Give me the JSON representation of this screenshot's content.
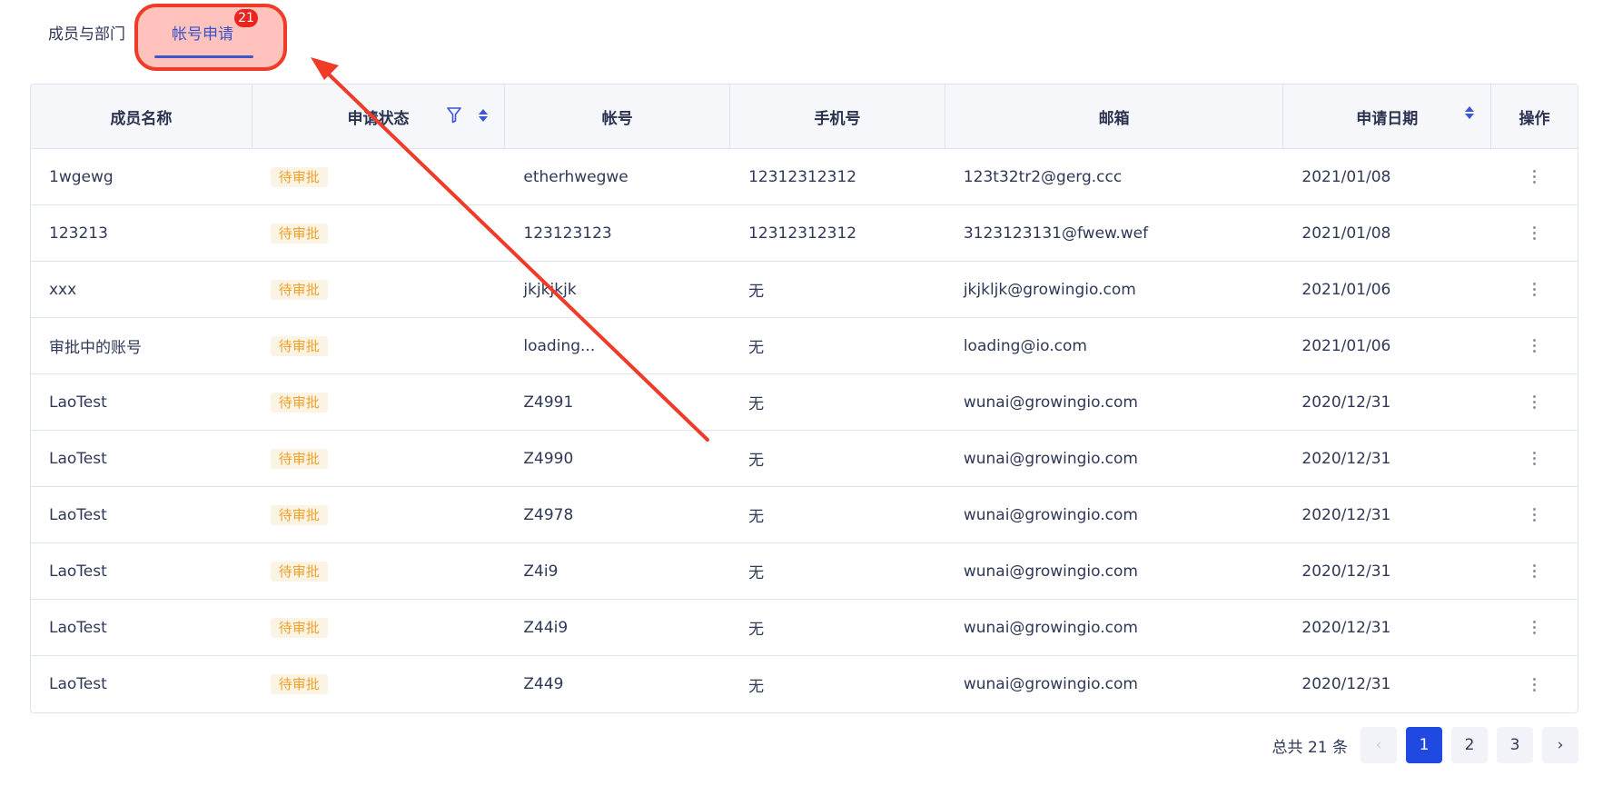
{
  "tabs": {
    "members_label": "成员与部门",
    "apply_label": "帐号申请",
    "apply_badge": "21"
  },
  "table": {
    "columns": [
      "成员名称",
      "申请状态",
      "帐号",
      "手机号",
      "邮箱",
      "申请日期",
      "操作"
    ],
    "rows": [
      {
        "name": "1wgewg",
        "status": "待审批",
        "account": "etherhwegwe",
        "phone": "12312312312",
        "email": "123t32tr2@gerg.ccc",
        "date": "2021/01/08"
      },
      {
        "name": "123213",
        "status": "待审批",
        "account": "123123123",
        "phone": "12312312312",
        "email": "3123123131@fwew.wef",
        "date": "2021/01/08"
      },
      {
        "name": "xxx",
        "status": "待审批",
        "account": "jkjkjkjk",
        "phone": "无",
        "email": "jkjkljk@growingio.com",
        "date": "2021/01/06"
      },
      {
        "name": "审批中的账号",
        "status": "待审批",
        "account": "loading...",
        "phone": "无",
        "email": "loading@io.com",
        "date": "2021/01/06"
      },
      {
        "name": "LaoTest",
        "status": "待审批",
        "account": "Z4991",
        "phone": "无",
        "email": "wunai@growingio.com",
        "date": "2020/12/31"
      },
      {
        "name": "LaoTest",
        "status": "待审批",
        "account": "Z4990",
        "phone": "无",
        "email": "wunai@growingio.com",
        "date": "2020/12/31"
      },
      {
        "name": "LaoTest",
        "status": "待审批",
        "account": "Z4978",
        "phone": "无",
        "email": "wunai@growingio.com",
        "date": "2020/12/31"
      },
      {
        "name": "LaoTest",
        "status": "待审批",
        "account": "Z4i9",
        "phone": "无",
        "email": "wunai@growingio.com",
        "date": "2020/12/31"
      },
      {
        "name": "LaoTest",
        "status": "待审批",
        "account": "Z44i9",
        "phone": "无",
        "email": "wunai@growingio.com",
        "date": "2020/12/31"
      },
      {
        "name": "LaoTest",
        "status": "待审批",
        "account": "Z449",
        "phone": "无",
        "email": "wunai@growingio.com",
        "date": "2020/12/31"
      }
    ]
  },
  "pagination": {
    "total_label": "总共 21 条",
    "prev": "‹",
    "next": "›",
    "pages": [
      "1",
      "2",
      "3"
    ],
    "current": "1"
  },
  "colors": {
    "accent": "#1f49e0",
    "tab_active": "#3a52c9",
    "status_pending": "#f0a12a",
    "annotation": "#ef3b28",
    "badge": "#e8251f"
  },
  "icons": {
    "filter": "filter-icon",
    "sort": "sort-icon",
    "row_action": "more-vertical-icon",
    "annotation": "arrow-icon"
  }
}
